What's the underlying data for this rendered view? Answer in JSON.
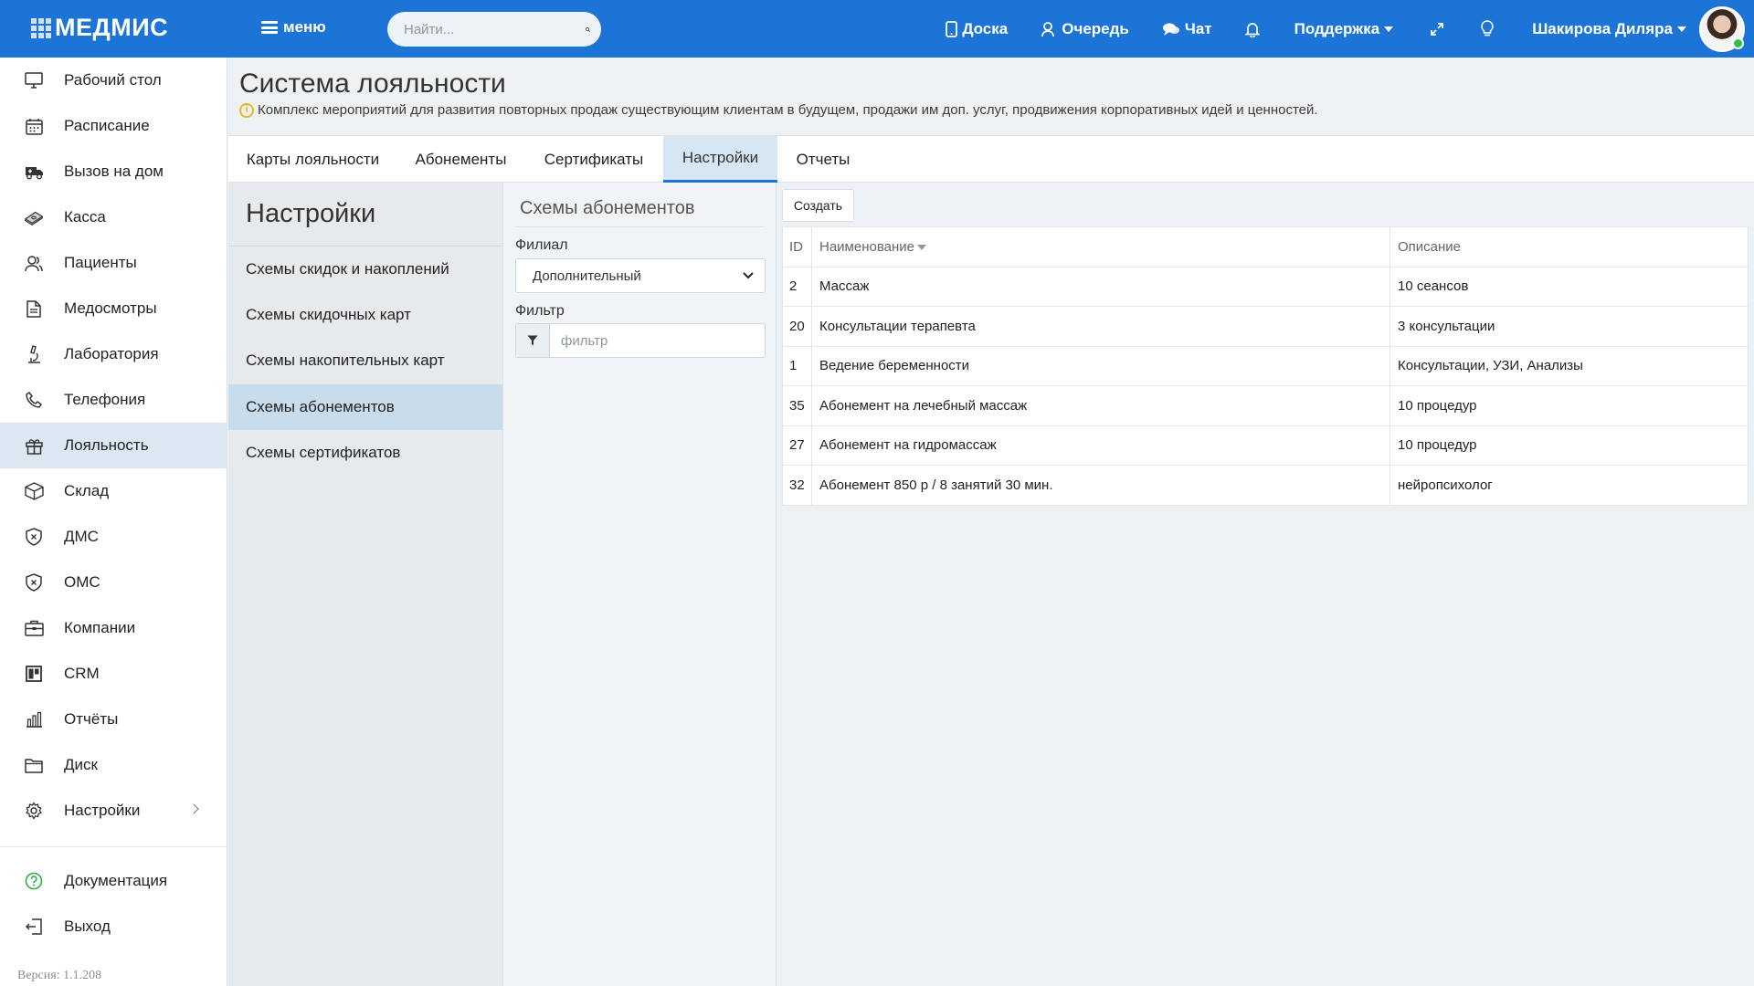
{
  "app": {
    "logo": "МЕДМИС",
    "menu_label": "меню",
    "search_placeholder": "Найти...",
    "nav": {
      "board": "Доска",
      "queue": "Очередь",
      "chat": "Чат",
      "support": "Поддержка",
      "user_name": "Шакирова Диляра"
    }
  },
  "sidebar": {
    "items": [
      {
        "label": "Рабочий стол",
        "icon": "monitor-icon"
      },
      {
        "label": "Расписание",
        "icon": "calendar-icon"
      },
      {
        "label": "Вызов на дом",
        "icon": "ambulance-icon"
      },
      {
        "label": "Касса",
        "icon": "cash-icon"
      },
      {
        "label": "Пациенты",
        "icon": "patients-icon"
      },
      {
        "label": "Медосмотры",
        "icon": "document-icon"
      },
      {
        "label": "Лаборатория",
        "icon": "microscope-icon"
      },
      {
        "label": "Телефония",
        "icon": "phone-icon"
      },
      {
        "label": "Лояльность",
        "icon": "gift-icon",
        "active": true
      },
      {
        "label": "Склад",
        "icon": "box-icon"
      },
      {
        "label": "ДМС",
        "icon": "shield-icon"
      },
      {
        "label": "ОМС",
        "icon": "shield-icon"
      },
      {
        "label": "Компании",
        "icon": "briefcase-icon"
      },
      {
        "label": "CRM",
        "icon": "crm-icon"
      },
      {
        "label": "Отчёты",
        "icon": "bar-chart-icon"
      },
      {
        "label": "Диск",
        "icon": "folder-icon"
      },
      {
        "label": "Настройки",
        "icon": "gear-icon"
      }
    ],
    "bottom_items": [
      {
        "label": "Документация",
        "icon": "help-icon"
      },
      {
        "label": "Выход",
        "icon": "logout-icon"
      }
    ],
    "version": "Версия: 1.1.208"
  },
  "page": {
    "title": "Система лояльности",
    "description": "Комплекс мероприятий для развития повторных продаж существующим клиентам в будущем, продажи им доп. услуг, продвижения корпоративных идей и ценностей."
  },
  "tabs": [
    {
      "label": "Карты лояльности"
    },
    {
      "label": "Абонементы"
    },
    {
      "label": "Сертификаты"
    },
    {
      "label": "Настройки",
      "active": true
    },
    {
      "label": "Отчеты"
    }
  ],
  "settings": {
    "title": "Настройки",
    "items": [
      {
        "label": "Схемы скидок и накоплений"
      },
      {
        "label": "Схемы скидочных карт"
      },
      {
        "label": "Схемы накопительных карт"
      },
      {
        "label": "Схемы абонементов",
        "active": true
      },
      {
        "label": "Схемы сертификатов"
      }
    ]
  },
  "filter_panel": {
    "title": "Схемы абонементов",
    "branch_label": "Филиал",
    "branch_value": "Дополнительный",
    "filter_label": "Фильтр",
    "filter_placeholder": "фильтр"
  },
  "table": {
    "create_label": "Создать",
    "columns": [
      "ID",
      "Наименование",
      "Описание"
    ],
    "rows": [
      {
        "id": "2",
        "name": "Массаж",
        "description": "10 сеансов"
      },
      {
        "id": "20",
        "name": "Консультации терапевта",
        "description": "3 консультации"
      },
      {
        "id": "1",
        "name": "Ведение беременности",
        "description": "Консультации, УЗИ, Анализы"
      },
      {
        "id": "35",
        "name": "Абонемент на лечебный массаж",
        "description": "10 процедур"
      },
      {
        "id": "27",
        "name": "Абонемент на гидромассаж",
        "description": "10 процедур"
      },
      {
        "id": "32",
        "name": "Абонемент 850 р / 8 занятий 30 мин.",
        "description": "нейропсихолог"
      }
    ]
  },
  "colors": {
    "topbar": "#1c74d6",
    "active_sidebar": "#dbe8f2",
    "active_setting": "#c8dcec",
    "info_icon": "#e9b62a",
    "online": "#2fbf4a"
  }
}
